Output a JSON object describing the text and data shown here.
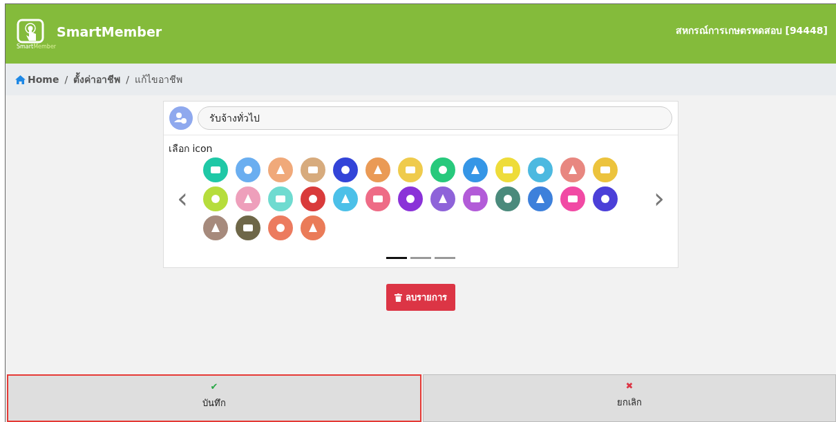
{
  "header": {
    "brand": "SmartMember",
    "logo_caption_a": "Smart",
    "logo_caption_b": "Member",
    "organization": "สหกรณ์การเกษตรทดสอบ [94448]"
  },
  "breadcrumb": [
    {
      "label": "Home",
      "kind": "home"
    },
    {
      "separator": "/",
      "label": "ตั้งค่าอาชีพ",
      "kind": "link"
    },
    {
      "separator": "/",
      "label": "แก้ไขอาชีพ",
      "kind": "current"
    }
  ],
  "occupation": {
    "value": "รับจ้างทั่วไป"
  },
  "icon_picker": {
    "label": "เลือก icon",
    "prev": "‹",
    "next": "›",
    "icons": [
      {
        "color": "#1fc8a6"
      },
      {
        "color": "#6aaef0"
      },
      {
        "color": "#f0a97a"
      },
      {
        "color": "#d7ab7d"
      },
      {
        "color": "#3344d8"
      },
      {
        "color": "#ea9a55"
      },
      {
        "color": "#efcb4c"
      },
      {
        "color": "#27c97c"
      },
      {
        "color": "#3596e6"
      },
      {
        "color": "#eedc3a"
      },
      {
        "color": "#4cb9e0"
      },
      {
        "color": "#e88780"
      },
      {
        "color": "#ecc33d"
      },
      {
        "color": "#b6dd3c"
      },
      {
        "color": "#ee9fbb"
      },
      {
        "color": "#6fdbd0"
      },
      {
        "color": "#d93b3b"
      },
      {
        "color": "#4cc0e8"
      },
      {
        "color": "#ee6b86"
      },
      {
        "color": "#8a32d8"
      },
      {
        "color": "#8e63d9"
      },
      {
        "color": "#b25bd8"
      },
      {
        "color": "#4a8a7c"
      },
      {
        "color": "#3d80db"
      },
      {
        "color": "#f14aa4"
      },
      {
        "color": "#4b3fd8"
      },
      {
        "color": "#a68a7c"
      },
      {
        "color": "#6e6748"
      },
      {
        "color": "#ec7b5f"
      },
      {
        "color": "#ea7b58"
      }
    ],
    "pages": [
      {
        "selected": true
      },
      {
        "selected": false
      },
      {
        "selected": false
      }
    ]
  },
  "delete_button": {
    "label": "ลบรายการ"
  },
  "footer": [
    {
      "label": "บันทึก",
      "kind": "save",
      "symbol": "✔",
      "focused": true
    },
    {
      "label": "ยกเลิก",
      "kind": "cancel",
      "symbol": "✖",
      "focused": false
    }
  ]
}
